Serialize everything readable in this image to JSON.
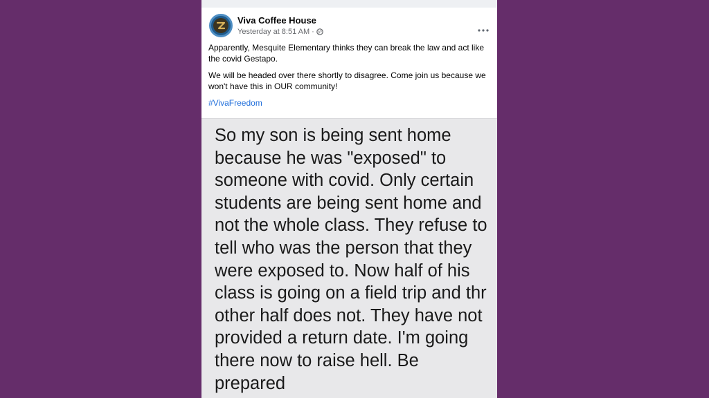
{
  "post": {
    "page_name": "Viva Coffee House",
    "timestamp": "Yesterday at 8:51 AM",
    "separator": "·",
    "privacy_icon": "globe-icon",
    "more_icon": "more-options-icon",
    "paragraphs": [
      "Apparently, Mesquite Elementary thinks they can break the law and act like the covid Gestapo.",
      "We will be headed over there shortly to disagree. Come join us because we won't have this in OUR community!"
    ],
    "hashtag": "#VivaFreedom",
    "image_text": "So my son is being sent home\nbecause he was \"exposed\" to\nsomeone with covid. Only certain\nstudents are being sent home and\nnot the whole class. They refuse to\ntell who was the person that they\nwere exposed to. Now half of his\nclass is going on a field trip and thr\nother half does not.  They have not\nprovided a return date. I'm going\nthere now to raise hell. Be prepared\nfor me to go to jail."
  },
  "colors": {
    "background": "#652d6a",
    "hashtag": "#216fdb",
    "meta": "#65676b"
  }
}
